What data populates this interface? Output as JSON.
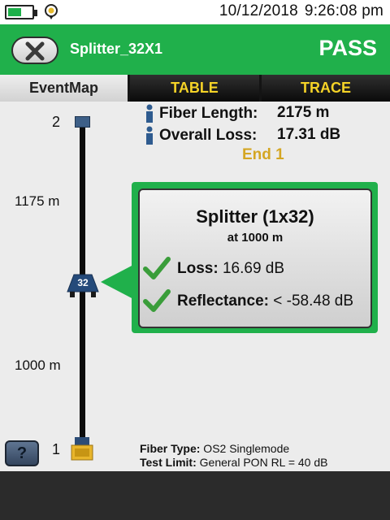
{
  "status": {
    "date": "10/12/2018",
    "time": "9:26:08 pm"
  },
  "header": {
    "file_name": "Splitter_32X1",
    "result": "PASS"
  },
  "tabs": [
    "EventMap",
    "TABLE",
    "TRACE"
  ],
  "summary": {
    "fiber_length_label": "Fiber Length:",
    "fiber_length_value": "2175 m",
    "overall_loss_label": "Overall Loss:",
    "overall_loss_value": "17.31 dB",
    "end_label": "End 1"
  },
  "map": {
    "top_end": "2",
    "bottom_end": "1",
    "distance_upper": "1175 m",
    "distance_lower": "1000 m",
    "splitter_ports": "32"
  },
  "event": {
    "title": "Splitter (1x32)",
    "position": "at 1000 m",
    "loss_label": "Loss:",
    "loss_value": " 16.69 dB",
    "reflectance_label": "Reflectance:",
    "reflectance_value": " < -58.48 dB"
  },
  "footer": {
    "help_label": "?",
    "fiber_type_label": "Fiber Type:",
    "fiber_type_value": " OS2 Singlemode",
    "test_limit_label": "Test Limit:",
    "test_limit_value": " General PON RL = 40 dB"
  },
  "colors": {
    "accent_green": "#20b04b",
    "tab_text_yellow": "#f5d327",
    "end_label_gold": "#d4a623",
    "info_blue": "#2e5b8f"
  },
  "icons": [
    "battery-icon",
    "location-pin-icon",
    "close-x-icon",
    "info-icon",
    "check-icon",
    "splitter-icon",
    "connector-icon"
  ]
}
